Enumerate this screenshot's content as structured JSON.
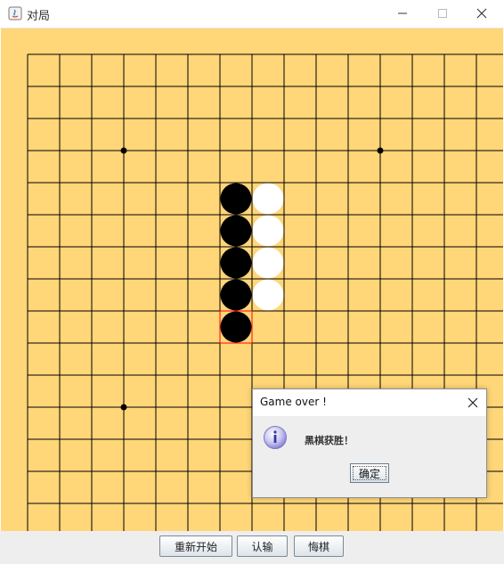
{
  "window": {
    "title": "对局",
    "icon": "java-icon",
    "controls": [
      "minimize-icon",
      "maximize-icon",
      "close-icon"
    ]
  },
  "board": {
    "size": 15,
    "line_color": "#000000",
    "background": "#ffd678",
    "star_points": [
      [
        3,
        3
      ],
      [
        11,
        3
      ],
      [
        3,
        11
      ]
    ],
    "stones": [
      {
        "color": "black",
        "col": 6,
        "row": 4
      },
      {
        "color": "black",
        "col": 6,
        "row": 5
      },
      {
        "color": "black",
        "col": 6,
        "row": 6
      },
      {
        "color": "black",
        "col": 6,
        "row": 7
      },
      {
        "color": "black",
        "col": 6,
        "row": 8
      },
      {
        "color": "white",
        "col": 7,
        "row": 4
      },
      {
        "color": "white",
        "col": 7,
        "row": 5
      },
      {
        "color": "white",
        "col": 7,
        "row": 6
      },
      {
        "color": "white",
        "col": 7,
        "row": 7
      }
    ],
    "last_move": {
      "col": 6,
      "row": 8
    },
    "last_move_color": "#ff0000"
  },
  "buttons": {
    "restart": "重新开始",
    "resign": "认输",
    "undo": "悔棋"
  },
  "dialog": {
    "title": "Game over !",
    "message": "黑棋获胜！",
    "ok": "确定",
    "icon": "info-icon"
  }
}
